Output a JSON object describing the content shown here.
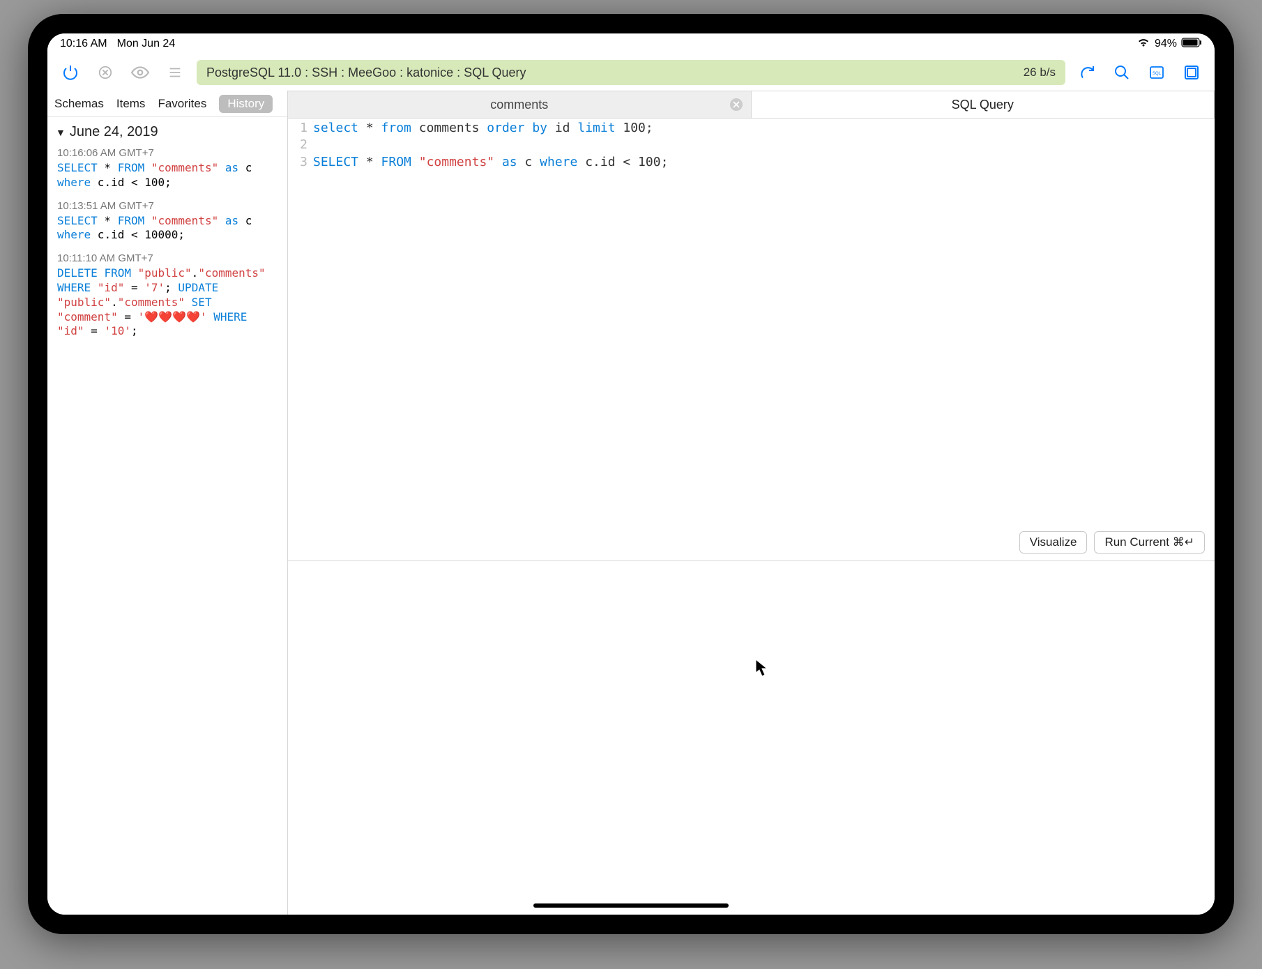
{
  "status_bar": {
    "time": "10:16 AM",
    "date": "Mon Jun 24",
    "battery_pct": "94%"
  },
  "toolbar": {
    "address": "PostgreSQL 11.0 : SSH : MeeGoo : katonice : SQL Query",
    "rate": "26 b/s"
  },
  "sidebar": {
    "tabs": {
      "schemas": "Schemas",
      "items": "Items",
      "favorites": "Favorites",
      "history": "History"
    },
    "header_date": "June 24, 2019",
    "history": [
      {
        "time": "10:16:06 AM GMT+7",
        "sql_tokens": [
          [
            "kw",
            "SELECT"
          ],
          [
            "txt",
            " * "
          ],
          [
            "kw",
            "FROM"
          ],
          [
            "txt",
            " "
          ],
          [
            "str",
            "\"comments\""
          ],
          [
            "txt",
            " "
          ],
          [
            "kw",
            "as"
          ],
          [
            "txt",
            " c "
          ],
          [
            "kw",
            "where"
          ],
          [
            "txt",
            " c.id < 100;"
          ]
        ]
      },
      {
        "time": "10:13:51 AM GMT+7",
        "sql_tokens": [
          [
            "kw",
            "SELECT"
          ],
          [
            "txt",
            " * "
          ],
          [
            "kw",
            "FROM"
          ],
          [
            "txt",
            " "
          ],
          [
            "str",
            "\"comments\""
          ],
          [
            "txt",
            " "
          ],
          [
            "kw",
            "as"
          ],
          [
            "txt",
            " c "
          ],
          [
            "kw",
            "where"
          ],
          [
            "txt",
            " c.id < 10000;"
          ]
        ]
      },
      {
        "time": "10:11:10 AM GMT+7",
        "sql_tokens": [
          [
            "kw",
            "DELETE"
          ],
          [
            "txt",
            " "
          ],
          [
            "kw",
            "FROM"
          ],
          [
            "txt",
            " "
          ],
          [
            "str",
            "\"public\""
          ],
          [
            "txt",
            "."
          ],
          [
            "str",
            "\"comments\""
          ],
          [
            "txt",
            " "
          ],
          [
            "kw",
            "WHERE"
          ],
          [
            "txt",
            " "
          ],
          [
            "str",
            "\"id\""
          ],
          [
            "txt",
            " = "
          ],
          [
            "str",
            "'7'"
          ],
          [
            "txt",
            "; "
          ],
          [
            "kw",
            "UPDATE"
          ],
          [
            "txt",
            " "
          ],
          [
            "str",
            "\"public\""
          ],
          [
            "txt",
            "."
          ],
          [
            "str",
            "\"comments\""
          ],
          [
            "txt",
            " "
          ],
          [
            "kw",
            "SET"
          ],
          [
            "txt",
            " "
          ],
          [
            "str",
            "\"comment\""
          ],
          [
            "txt",
            " = "
          ],
          [
            "str",
            "'❤️❤️❤️❤️'"
          ],
          [
            "txt",
            " "
          ],
          [
            "kw",
            "WHERE"
          ],
          [
            "txt",
            " "
          ],
          [
            "str",
            "\"id\""
          ],
          [
            "txt",
            " = "
          ],
          [
            "str",
            "'10'"
          ],
          [
            "txt",
            ";"
          ]
        ]
      }
    ]
  },
  "tabs": {
    "left": "comments",
    "right": "SQL Query"
  },
  "editor": {
    "lines": [
      [
        [
          "kw",
          "select"
        ],
        [
          "txt",
          " * "
        ],
        [
          "kw",
          "from"
        ],
        [
          "txt",
          " comments "
        ],
        [
          "kw",
          "order"
        ],
        [
          "txt",
          " "
        ],
        [
          "kw",
          "by"
        ],
        [
          "txt",
          " id "
        ],
        [
          "kw",
          "limit"
        ],
        [
          "txt",
          " 100;"
        ]
      ],
      [],
      [
        [
          "kw",
          "SELECT"
        ],
        [
          "txt",
          " * "
        ],
        [
          "kw",
          "FROM"
        ],
        [
          "txt",
          " "
        ],
        [
          "str",
          "\"comments\""
        ],
        [
          "txt",
          " "
        ],
        [
          "kw",
          "as"
        ],
        [
          "txt",
          " c "
        ],
        [
          "kw",
          "where"
        ],
        [
          "txt",
          " c.id < 100;"
        ]
      ]
    ]
  },
  "buttons": {
    "visualize": "Visualize",
    "run": "Run Current ⌘↵"
  }
}
